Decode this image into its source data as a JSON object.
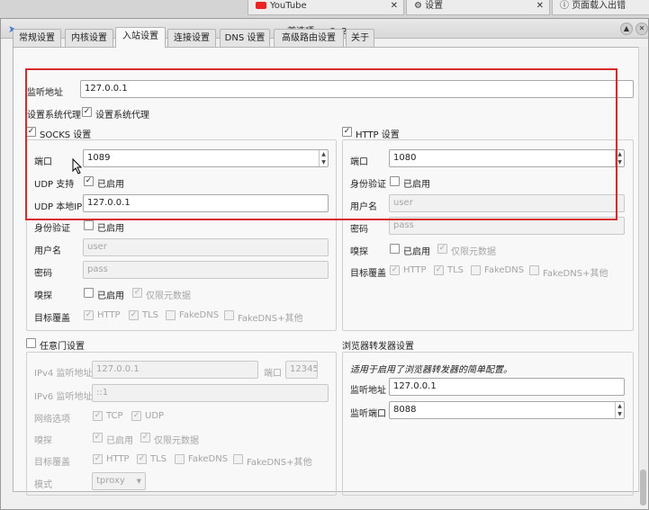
{
  "browser": {
    "tab1": "YouTube",
    "tab2": "设置",
    "tab3": "页面载入出错"
  },
  "window": {
    "title": "首选项 — Qv2ray"
  },
  "tabs": [
    "常规设置",
    "内核设置",
    "入站设置",
    "连接设置",
    "DNS 设置",
    "高级路由设置",
    "关于"
  ],
  "listen": {
    "label": "监听地址",
    "value": "127.0.0.1"
  },
  "sysproxy": {
    "label": "设置系统代理",
    "check_label": "设置系统代理"
  },
  "socks": {
    "title": "SOCKS 设置",
    "port_label": "端口",
    "port": "1089",
    "udp_label": "UDP 支持",
    "udp_check": "已启用",
    "udpip_label": "UDP 本地IP",
    "udpip": "127.0.0.1",
    "auth_label": "身份验证",
    "auth_check": "已启用",
    "user_label": "用户名",
    "user_ph": "user",
    "pass_label": "密码",
    "pass_ph": "pass",
    "sniff_label": "嗅探",
    "sniff_check": "已启用",
    "meta_check": "仅限元数据",
    "target_label": "目标覆盖",
    "t1": "HTTP",
    "t2": "TLS",
    "t3": "FakeDNS",
    "t4": "FakeDNS+其他"
  },
  "http": {
    "title": "HTTP 设置",
    "port_label": "端口",
    "port": "1080",
    "auth_label": "身份验证",
    "auth_check": "已启用",
    "user_label": "用户名",
    "user_ph": "user",
    "pass_label": "密码",
    "pass_ph": "pass",
    "sniff_label": "嗅探",
    "sniff_check": "已启用",
    "meta_check": "仅限元数据",
    "target_label": "目标覆盖",
    "t1": "HTTP",
    "t2": "TLS",
    "t3": "FakeDNS",
    "t4": "FakeDNS+其他"
  },
  "tproxy": {
    "title": "任意门设置",
    "ipv4_label": "IPv4 监听地址",
    "ipv4": "127.0.0.1",
    "port_label": "端口",
    "port": "12345",
    "ipv6_label": "IPv6 监听地址",
    "ipv6": "::1",
    "net_label": "网络选项",
    "tcp": "TCP",
    "udp": "UDP",
    "sniff_label": "嗅探",
    "sniff_check": "已启用",
    "meta_check": "仅限元数据",
    "target_label": "目标覆盖",
    "t1": "HTTP",
    "t2": "TLS",
    "t3": "FakeDNS",
    "t4": "FakeDNS+其他",
    "mode_label": "模式",
    "mode": "tproxy"
  },
  "fwd": {
    "title": "浏览器转发器设置",
    "desc": "适用于启用了浏览器转发器的简单配置。",
    "addr_label": "监听地址",
    "addr": "127.0.0.1",
    "port_label": "监听端口",
    "port": "8088"
  }
}
